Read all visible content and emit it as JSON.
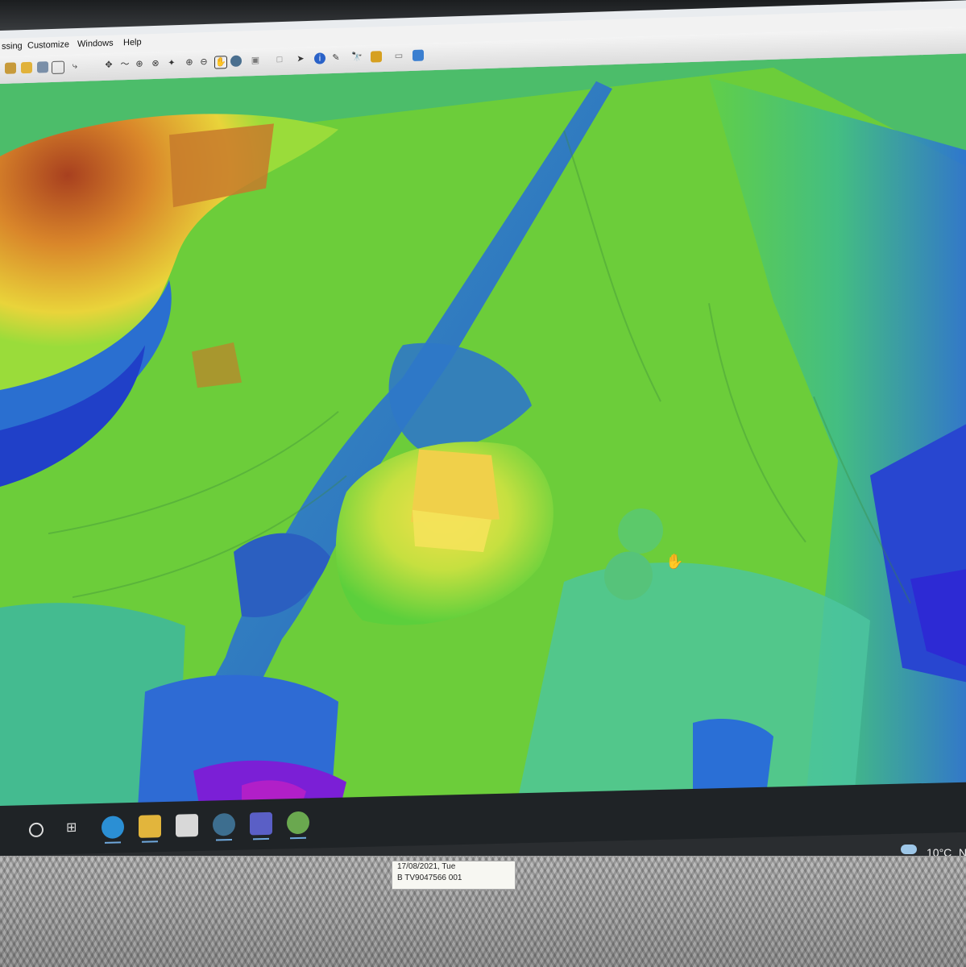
{
  "menu": {
    "items": [
      "ssing",
      "Customize",
      "Windows",
      "Help"
    ]
  },
  "toolbar": {
    "icons": [
      "layer-icon",
      "folder-icon",
      "editor-icon",
      "table-icon",
      "hyperlink-icon",
      "pan-icon",
      "zoom-in-icon",
      "zoom-out-icon",
      "pan-hand-icon",
      "globe-icon",
      "select-icon",
      "identify-icon",
      "find-icon",
      "measure-icon",
      "3d-view-icon"
    ]
  },
  "taskbar": {
    "icons": [
      "search-circle-icon",
      "task-view-icon",
      "edge-icon",
      "file-explorer-icon",
      "store-icon",
      "magnifier-app-icon",
      "teams-icon",
      "gis-app-icon"
    ],
    "weather_temp": "10°C",
    "weather_extra": "N"
  },
  "sticker": {
    "line1": "17/08/2021, Tue",
    "line2": "B TV9047566 001"
  },
  "colors": {
    "map_high": "#c0502a",
    "map_mid": "#6ed23a",
    "map_low": "#2f6fd6",
    "map_lowest": "#7b1fd6"
  }
}
